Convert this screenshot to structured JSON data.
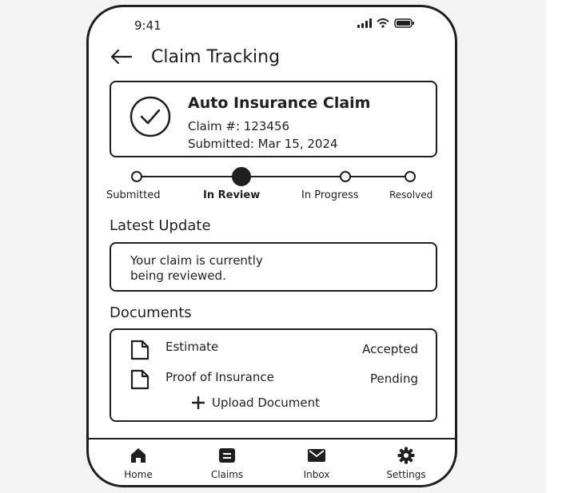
{
  "status_bar": {
    "time": "9:41"
  },
  "header": {
    "title": "Claim Tracking"
  },
  "claim": {
    "title": "Auto Insurance Claim",
    "number": "Claim #: 123456",
    "submitted": "Submitted: Mar 15, 2024"
  },
  "progress": {
    "steps": [
      "Submitted",
      "In Review",
      "In Progress",
      "Resolved"
    ],
    "current_step": "In Review"
  },
  "latest_update": {
    "heading": "Latest Update",
    "line1": "Your claim is currently",
    "line2": "being reviewed."
  },
  "documents": {
    "heading": "Documents",
    "items": [
      {
        "name": "Estimate",
        "status": "Accepted"
      },
      {
        "name": "Proof of Insurance",
        "status": "Pending"
      }
    ],
    "upload_label": "Upload Document"
  },
  "tabs": [
    {
      "label": "Home",
      "icon": "home-icon"
    },
    {
      "label": "Claims",
      "icon": "claims-icon"
    },
    {
      "label": "Inbox",
      "icon": "inbox-icon"
    },
    {
      "label": "Settings",
      "icon": "gear-icon"
    }
  ],
  "colors": {
    "ink": "#1f1f1f",
    "background": "#ffffff"
  }
}
